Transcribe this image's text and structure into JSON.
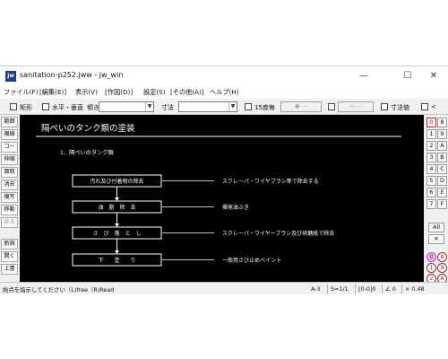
{
  "window": {
    "app_icon": "jw",
    "title": "sanitation-p252.jww - jw_win",
    "controls": {
      "minimize": "—",
      "maximize": "☐",
      "close": "✕"
    }
  },
  "menu": [
    "ファイル(F)",
    "[編集(E)]",
    "表示(V)",
    "[作図(D)]",
    "設定(S)",
    "[その他(A)]",
    "ヘルプ(H)"
  ],
  "toolbar": {
    "rect_label": "矩形",
    "hv_label": "水平・垂直",
    "tilt_label": "傾き",
    "dim_label": "寸法",
    "deg15_label": "15度毎",
    "dot_box": "●----",
    "arrow_box": "<----",
    "dimval_label": "寸法値",
    "lt_label": "<"
  },
  "left_tools": [
    {
      "label": "範囲",
      "enabled": true
    },
    {
      "label": "複線",
      "enabled": true
    },
    {
      "label": "コーナー",
      "enabled": true
    },
    {
      "label": "伸縮",
      "enabled": true
    },
    {
      "label": "面取",
      "enabled": true
    },
    {
      "label": "消去",
      "enabled": true
    },
    {
      "label": "複写",
      "enabled": true
    },
    {
      "label": "移動",
      "enabled": true
    },
    {
      "label": "戻る",
      "enabled": false
    },
    {
      "label": "新規",
      "enabled": true
    },
    {
      "label": "開く",
      "enabled": true
    },
    {
      "label": "上書",
      "enabled": true
    }
  ],
  "right_tools": {
    "layer_left": [
      "0",
      "1",
      "2",
      "3",
      "4",
      "5",
      "6",
      "7"
    ],
    "layer_right": [
      "8",
      "9",
      "A",
      "B",
      "C",
      "D",
      "E",
      "F"
    ],
    "all_label": "All",
    "x_label": "✕",
    "circles": [
      "0",
      "8",
      "1",
      "9",
      "2",
      "A"
    ]
  },
  "drawing": {
    "title": "隔ぺいのタンク類の塗装",
    "section": "1．隔ぺいのタンク類",
    "steps": [
      {
        "box": "汚れ及び付着物の除去",
        "note": "スクレーパ・ワイヤブラシ等で除去する"
      },
      {
        "box": "油　脂　除　去",
        "note": "揮発油ぶき"
      },
      {
        "box": "さ　び　落　と　し",
        "note": "スクレーパ・ワイヤーブラシ及び研磨紙で除去"
      },
      {
        "box": "下　　塗　　り",
        "note": "一般用さび止めペイント"
      }
    ]
  },
  "status": {
    "message": "始点を指示してください（L)free（R)Read",
    "paper": "A-3",
    "scale": "S=1/1",
    "layer": "[0-0]0",
    "angle": "∠ 0",
    "zoom": "× 0.48"
  }
}
